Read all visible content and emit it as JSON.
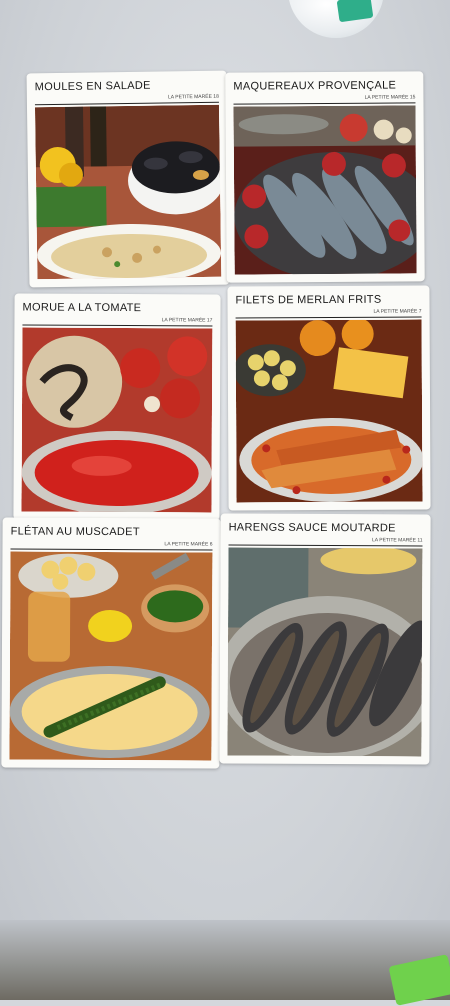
{
  "cards": [
    {
      "title": "MOULES EN SALADE",
      "subtitle": "LA PETITE MARÉE 18"
    },
    {
      "title": "MAQUEREAUX PROVENÇALE",
      "subtitle": "LA PETITE MARÉE 15"
    },
    {
      "title": "MORUE A LA TOMATE",
      "subtitle": "LA PETITE MARÉE 17"
    },
    {
      "title": "FILETS DE MERLAN FRITS",
      "subtitle": "LA PETITE MARÉE 7"
    },
    {
      "title": "FLÉTAN AU MUSCADET",
      "subtitle": "LA PETITE MARÉE 6"
    },
    {
      "title": "HARENGS SAUCE MOUTARDE",
      "subtitle": "LA PETITE MARÉE 11"
    }
  ]
}
